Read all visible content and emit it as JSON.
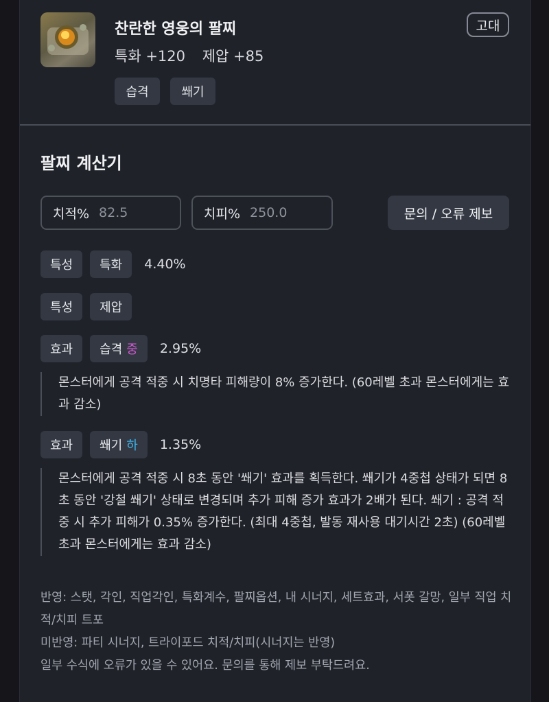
{
  "item": {
    "name": "찬란한 영웅의 팔찌",
    "stats": [
      "특화 +120",
      "제압 +85"
    ],
    "grade": "고대",
    "tags": [
      "습격",
      "쐐기"
    ]
  },
  "calculator": {
    "title": "팔찌 계산기",
    "crit_rate": {
      "label": "치적%",
      "value": "82.5"
    },
    "crit_damage": {
      "label": "치피%",
      "value": "250.0"
    },
    "report_button": "문의 / 오류 제보"
  },
  "rows": [
    {
      "kind": "특성",
      "name": "특화",
      "value": "4.40%"
    },
    {
      "kind": "특성",
      "name": "제압",
      "value": ""
    },
    {
      "kind": "효과",
      "name": "습격",
      "grade": "중",
      "value": "2.95%",
      "description": "몬스터에게 공격 적중 시 치명타 피해량이 8% 증가한다. (60레벨 초과 몬스터에게는 효과 감소)"
    },
    {
      "kind": "효과",
      "name": "쐐기",
      "grade": "하",
      "value": "1.35%",
      "description": "몬스터에게 공격 적중 시 8초 동안 '쐐기' 효과를 획득한다. 쐐기가 4중첩 상태가 되면 8초 동안 '강철 쐐기' 상태로 변경되며 추가 피해 증가 효과가 2배가 된다. 쐐기 : 공격 적중 시 추가 피해가 0.35% 증가한다. (최대 4중첩, 발동 재사용 대기시간 2초) (60레벨 초과 몬스터에게는 효과 감소)"
    }
  ],
  "footer": {
    "reflected": "반영: 스탯, 각인, 직업각인, 특화계수, 팔찌옵션, 내 시너지, 세트효과, 서폿 갈망, 일부 직업 치적/치피 트포",
    "not_reflected": "미반영: 파티 시너지, 트라이포드 치적/치피(시너지는 반영)",
    "notice": "일부 수식에 오류가 있을 수 있어요. 문의를 통해 제보 부탁드려요."
  },
  "colors": {
    "grade_mid": "#d35bd6",
    "grade_low": "#3fb4ea",
    "background": "#1f2229"
  }
}
